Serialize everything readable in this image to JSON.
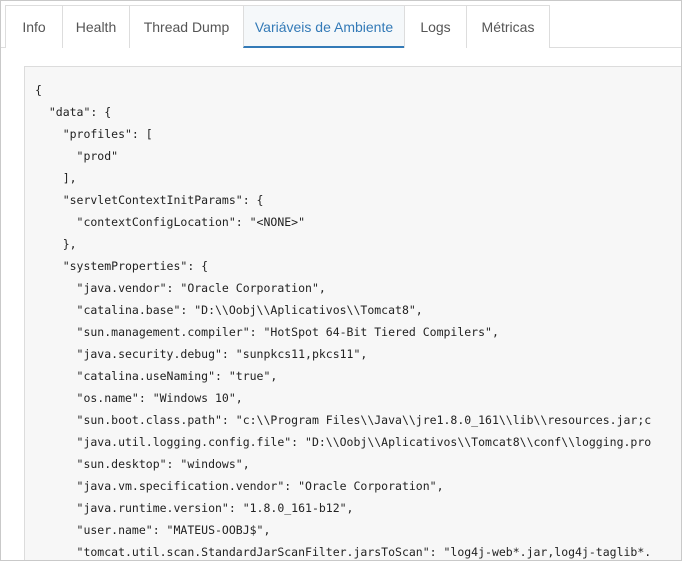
{
  "tabs": [
    {
      "label": "Info",
      "active": false
    },
    {
      "label": "Health",
      "active": false
    },
    {
      "label": "Thread Dump",
      "active": false
    },
    {
      "label": "Variáveis de Ambiente",
      "active": true
    },
    {
      "label": "Logs",
      "active": false
    },
    {
      "label": "Métricas",
      "active": false
    }
  ],
  "colors": {
    "accent": "#337ab7",
    "panel_bg": "#f7f7f7",
    "text": "#222222"
  },
  "code_lines": [
    "{",
    "  \"data\": {",
    "    \"profiles\": [",
    "      \"prod\"",
    "    ],",
    "    \"servletContextInitParams\": {",
    "      \"contextConfigLocation\": \"<NONE>\"",
    "    },",
    "    \"systemProperties\": {",
    "      \"java.vendor\": \"Oracle Corporation\",",
    "      \"catalina.base\": \"D:\\\\Oobj\\\\Aplicativos\\\\Tomcat8\",",
    "      \"sun.management.compiler\": \"HotSpot 64-Bit Tiered Compilers\",",
    "      \"java.security.debug\": \"sunpkcs11,pkcs11\",",
    "      \"catalina.useNaming\": \"true\",",
    "      \"os.name\": \"Windows 10\",",
    "      \"sun.boot.class.path\": \"c:\\\\Program Files\\\\Java\\\\jre1.8.0_161\\\\lib\\\\resources.jar;c",
    "      \"java.util.logging.config.file\": \"D:\\\\Oobj\\\\Aplicativos\\\\Tomcat8\\\\conf\\\\logging.pro",
    "      \"sun.desktop\": \"windows\",",
    "      \"java.vm.specification.vendor\": \"Oracle Corporation\",",
    "      \"java.runtime.version\": \"1.8.0_161-b12\",",
    "      \"user.name\": \"MATEUS-OOBJ$\",",
    "      \"tomcat.util.scan.StandardJarScanFilter.jarsToScan\": \"log4j-web*.jar,log4j-taglib*."
  ]
}
